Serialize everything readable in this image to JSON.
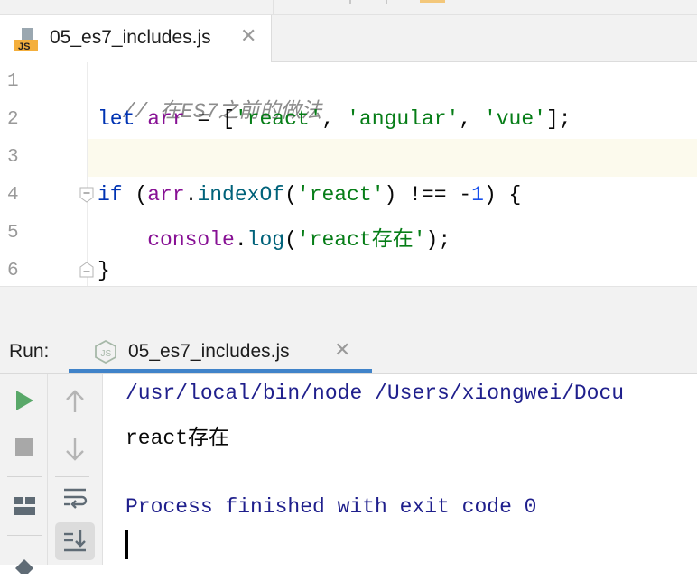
{
  "editor": {
    "tab_title": "05_es7_includes.js",
    "file_icon_label": "JS",
    "line_numbers": [
      "1",
      "2",
      "3",
      "4",
      "5",
      "6"
    ],
    "lines": {
      "l1": {
        "comment": "// 在ES7之前的做法"
      },
      "l2": {
        "kw": "let",
        "s1": " ",
        "var": "arr",
        "s2": " = [",
        "str1": "'react'",
        "s3": ", ",
        "str2": "'angular'",
        "s4": ", ",
        "str3": "'vue'",
        "s5": "];"
      },
      "l4": {
        "kw": "if",
        "s1": " (",
        "var": "arr",
        "s2": ".",
        "fn": "indexOf",
        "s3": "(",
        "str": "'react'",
        "s4": ") !== -",
        "num": "1",
        "s5": ") {"
      },
      "l5": {
        "indent": "    ",
        "var": "console",
        "s1": ".",
        "fn": "log",
        "s2": "(",
        "str": "'react存在'",
        "s3": ");"
      },
      "l6": {
        "text": "}"
      }
    }
  },
  "run": {
    "label": "Run:",
    "tab_title": "05_es7_includes.js",
    "console": {
      "command": "/usr/local/bin/node /Users/xiongwei/Docu",
      "output": "react存在",
      "exit": "Process finished with exit code 0"
    }
  },
  "colors": {
    "keyword": "#0033b3",
    "string": "#067d17",
    "number": "#1750eb",
    "variable": "#871094",
    "function": "#00627a",
    "comment": "#8c8c8c",
    "run_green": "#59a869",
    "tab_underline": "#4083c9",
    "console_blue": "#1f1f8c"
  }
}
